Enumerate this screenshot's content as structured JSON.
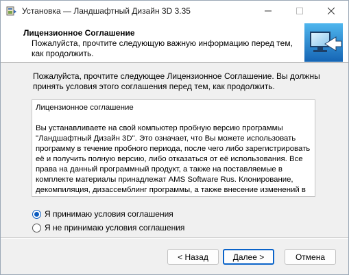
{
  "window": {
    "title": "Установка — Ландшафтный Дизайн 3D 3.35",
    "icons": {
      "app": "installer-icon",
      "minimize": "minimize-icon",
      "maximize": "maximize-icon",
      "close": "close-icon"
    }
  },
  "header": {
    "title": "Лицензионное Соглашение",
    "subtitle": "Пожалуйста, прочтите следующую важную информацию перед тем, как продолжить.",
    "art_icon": "monitor-arrow-icon"
  },
  "intro": "Пожалуйста, прочтите следующее Лицензионное Соглашение. Вы должны принять условия этого соглашения перед тем, как продолжить.",
  "license": {
    "heading": "Лицензионное соглашение",
    "body": "Вы устанавливаете на свой компьютер пробную версию программы \"Ландшафтный Дизайн 3D\". Это означает, что Вы можете использовать программу в течение пробного периода, после чего либо зарегистрировать её и получить полную версию, либо отказаться от её использования. Все права на данный программный продукт, а также на поставляемые в комплекте материалы принадлежат AMS Software Rus. Клонирование, декомпиляция, дизассемблинг программы, а также внесение изменений в данное лицензионное соглашение запрещено законом."
  },
  "options": {
    "accept": {
      "label": "Я принимаю условия соглашения",
      "selected": true
    },
    "decline": {
      "label": "Я не принимаю условия соглашения",
      "selected": false
    }
  },
  "buttons": {
    "back": "< Назад",
    "next": "Далее >",
    "cancel": "Отмена"
  },
  "colors": {
    "accent": "#0a63c9"
  }
}
